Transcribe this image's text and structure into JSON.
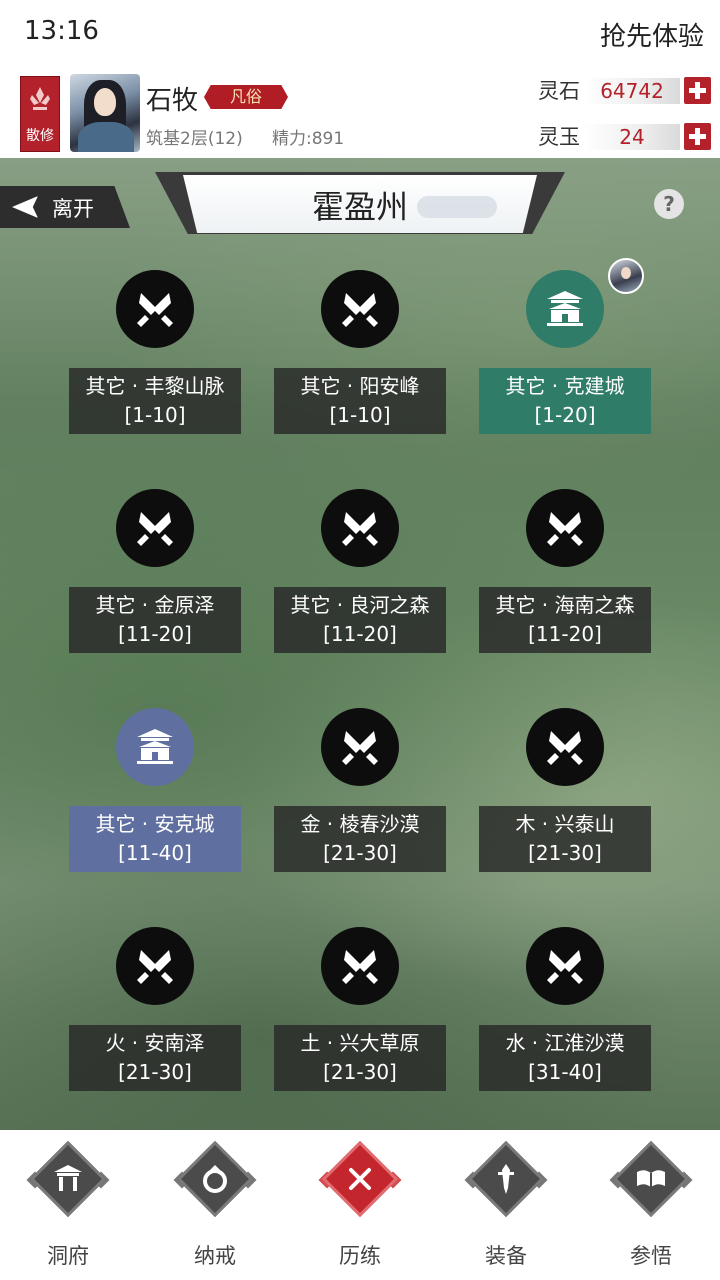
{
  "status": {
    "time": "13:16",
    "trial_label": "抢先体验"
  },
  "player": {
    "sect_label": "散修",
    "name": "石牧",
    "rank": "凡俗",
    "realm": "筑基2层(12)",
    "energy": "精力:891"
  },
  "currency": {
    "stone": {
      "label": "灵石",
      "value": "64742"
    },
    "jade": {
      "label": "灵玉",
      "value": "24"
    }
  },
  "map": {
    "leave_label": "离开",
    "title": "霍盈州",
    "help": "?"
  },
  "locations": [
    {
      "name": "其它 · 丰黎山脉",
      "range": "[1-10]",
      "type": "battle"
    },
    {
      "name": "其它 · 阳安峰",
      "range": "[1-10]",
      "type": "battle"
    },
    {
      "name": "其它 · 克建城",
      "range": "[1-20]",
      "type": "city"
    },
    {
      "name": "其它 · 金原泽",
      "range": "[11-20]",
      "type": "battle"
    },
    {
      "name": "其它 · 良河之森",
      "range": "[11-20]",
      "type": "battle"
    },
    {
      "name": "其它 · 海南之森",
      "range": "[11-20]",
      "type": "battle"
    },
    {
      "name": "其它 · 安克城",
      "range": "[11-40]",
      "type": "city"
    },
    {
      "name": "金 · 棱春沙漠",
      "range": "[21-30]",
      "type": "battle"
    },
    {
      "name": "木 · 兴泰山",
      "range": "[21-30]",
      "type": "battle"
    },
    {
      "name": "火 · 安南泽",
      "range": "[21-30]",
      "type": "battle"
    },
    {
      "name": "土 · 兴大草原",
      "range": "[21-30]",
      "type": "battle"
    },
    {
      "name": "水 · 江淮沙漠",
      "range": "[31-40]",
      "type": "battle"
    }
  ],
  "nav": [
    {
      "label": "洞府",
      "icon": "cave-dwelling-icon"
    },
    {
      "label": "纳戒",
      "icon": "storage-ring-icon"
    },
    {
      "label": "历练",
      "icon": "crossed-swords-icon",
      "active": true
    },
    {
      "label": "装备",
      "icon": "equipment-icon"
    },
    {
      "label": "参悟",
      "icon": "comprehension-book-icon"
    }
  ],
  "colors": {
    "accent_red": "#b3212a",
    "city_green": "#2f7c69",
    "city_blue": "#5f6fa0"
  }
}
